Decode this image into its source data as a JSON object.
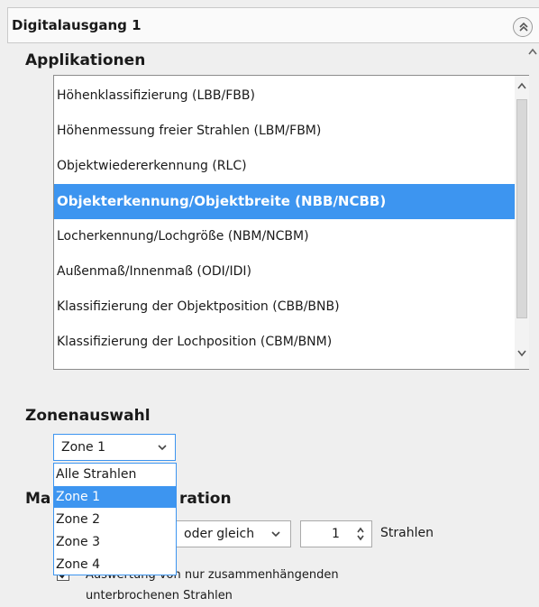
{
  "panel": {
    "title": "Digitalausgang 1",
    "collapse_icon": "double-chevron-up-icon"
  },
  "applications": {
    "title": "Applikationen",
    "items": [
      "Höhenklassifizierung (LBB/FBB)",
      "Höhenmessung freier Strahlen (LBM/FBM)",
      "Objektwiedererkennung (RLC)",
      "Objekterkennung/Objektbreite (NBB/NCBB)",
      "Locherkennung/Lochgröße (NBM/NCBM)",
      "Außenmaß/Innenmaß (ODI/IDI)",
      "Klassifizierung der Objektposition (CBB/BNB)",
      "Klassifizierung der Lochposition (CBM/BNM)"
    ],
    "selected": "Objekterkennung/Objektbreite (NBB/NCBB)"
  },
  "zone": {
    "title": "Zonenauswahl",
    "value": "Zone 1",
    "options": [
      "Alle Strahlen",
      "Zone 1",
      "Zone 2",
      "Zone 3",
      "Zone 4"
    ],
    "selected": "Zone 1"
  },
  "config": {
    "title_left": "Ma",
    "title_right": "ration",
    "mode_value": "oder gleich",
    "count_value": "1",
    "count_unit": "Strahlen",
    "checkbox_checked": true,
    "checkbox_line1": "Auswertung von nur zusammenhängenden",
    "checkbox_line2": "unterbrochenen Strahlen"
  },
  "colors": {
    "accent": "#3d95f0",
    "background": "#efefef"
  }
}
